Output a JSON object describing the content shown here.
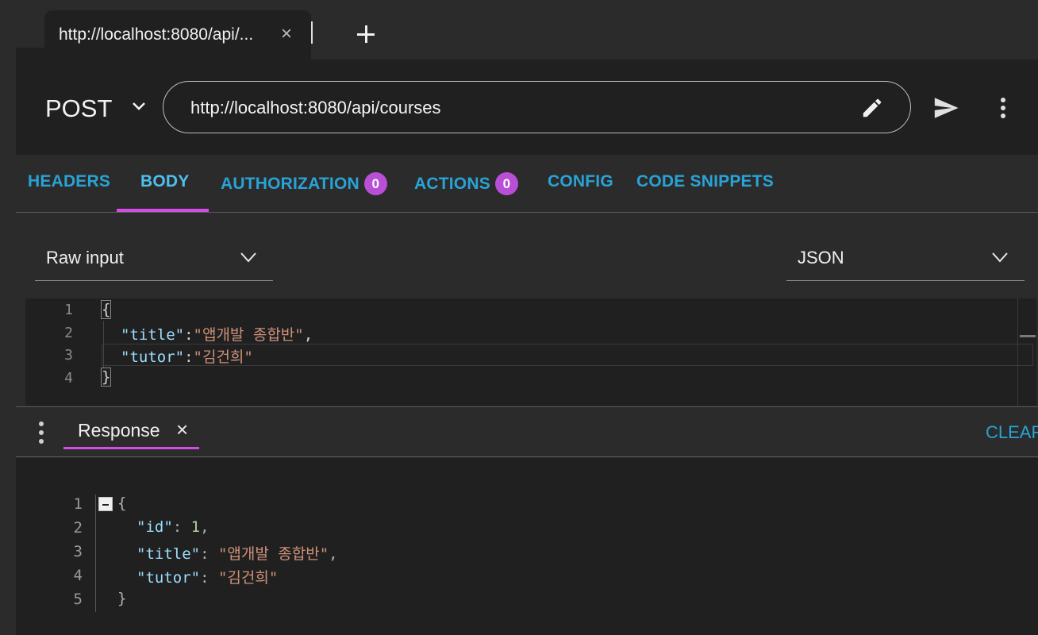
{
  "tab": {
    "title": "http://localhost:8080/api/...",
    "close": "×"
  },
  "request": {
    "method": "POST",
    "url": "http://localhost:8080/api/courses"
  },
  "config_tabs": [
    {
      "label": "HEADERS"
    },
    {
      "label": "BODY",
      "active": true
    },
    {
      "label": "AUTHORIZATION",
      "badge": "0"
    },
    {
      "label": "ACTIONS",
      "badge": "0"
    },
    {
      "label": "CONFIG"
    },
    {
      "label": "CODE SNIPPETS"
    }
  ],
  "body": {
    "input_type": "Raw input",
    "content_type": "JSON",
    "editor": {
      "line_numbers": [
        "1",
        "2",
        "3",
        "4"
      ],
      "lines": [
        {
          "open": "{"
        },
        {
          "key": "\"title\"",
          "sep": ":",
          "value": "\"앱개발 종합반\"",
          "tail": ","
        },
        {
          "key": "\"tutor\"",
          "sep": ":",
          "value": "\"김건희\"",
          "tail": ""
        },
        {
          "close": "}"
        }
      ]
    }
  },
  "response": {
    "tab_label": "Response",
    "close": "×",
    "clear_label": "CLEAR",
    "line_numbers": [
      "1",
      "2",
      "3",
      "4",
      "5"
    ],
    "lines": [
      {
        "open": "{"
      },
      {
        "key": "\"id\"",
        "sep": ": ",
        "value": "1",
        "tail": ","
      },
      {
        "key": "\"title\"",
        "sep": ": ",
        "value": "\"앱개발 종합반\"",
        "tail": ","
      },
      {
        "key": "\"tutor\"",
        "sep": ": ",
        "value": "\"김건희\"",
        "tail": ""
      },
      {
        "close": "}"
      }
    ]
  },
  "colors": {
    "accent_blue": "#29a3d6",
    "accent_magenta": "#d44ce6",
    "badge_purple": "#b94fd6"
  }
}
